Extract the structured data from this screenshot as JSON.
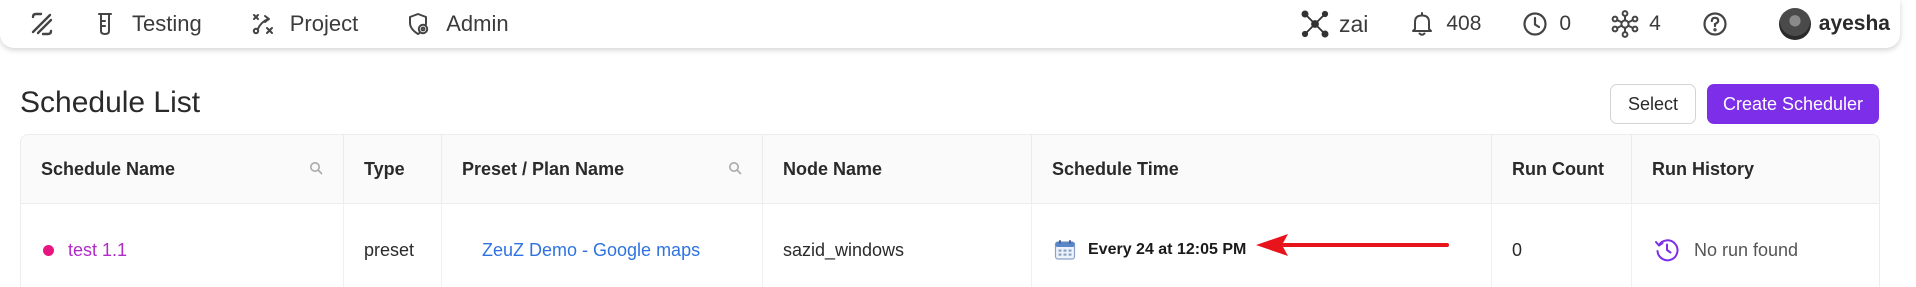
{
  "nav": {
    "logo": "zeuz-logo-icon",
    "items": [
      {
        "label": "Testing",
        "icon": "test-tube-icon"
      },
      {
        "label": "Project",
        "icon": "project-icon"
      },
      {
        "label": "Admin",
        "icon": "shield-gear-icon"
      }
    ],
    "right": {
      "zai_label": "zai",
      "notifications_count": "408",
      "pending_count": "0",
      "nodes_count": "4",
      "help_icon": "help-icon",
      "user_name": "ayesha"
    }
  },
  "page": {
    "title": "Schedule List",
    "select_label": "Select",
    "create_label": "Create Scheduler"
  },
  "table": {
    "columns": [
      "Schedule Name",
      "Type",
      "Preset / Plan Name",
      "Node Name",
      "Schedule Time",
      "Run Count",
      "Run History"
    ],
    "rows": [
      {
        "schedule_name": "test 1.1",
        "type": "preset",
        "preset_name": "ZeuZ Demo - Google maps",
        "node_name": "sazid_windows",
        "schedule_time": "Every 24 at 12:05 PM",
        "run_count": "0",
        "run_history": "No run found"
      }
    ]
  },
  "colors": {
    "accent": "#7c2ee8",
    "status_dot": "#e6157f",
    "link_schedule": "#b02cc8",
    "link_preset": "#2f73e0",
    "annotation_arrow": "#e8141b"
  }
}
